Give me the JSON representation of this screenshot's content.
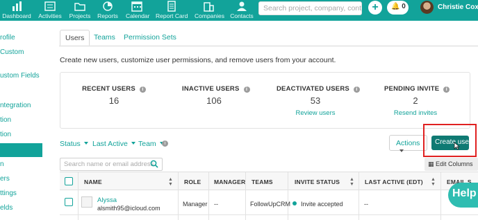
{
  "topnav": {
    "items": [
      {
        "label": "Dashboard",
        "icon": "bar-chart-icon"
      },
      {
        "label": "Activities",
        "icon": "activities-icon"
      },
      {
        "label": "Projects",
        "icon": "folder-icon"
      },
      {
        "label": "Reports",
        "icon": "reports-icon"
      },
      {
        "label": "Calendar",
        "icon": "calendar-icon"
      },
      {
        "label": "Report Card",
        "icon": "report-card-icon"
      },
      {
        "label": "Companies",
        "icon": "companies-icon"
      },
      {
        "label": "Contacts",
        "icon": "contacts-icon"
      }
    ],
    "search_placeholder": "Search project, company, contact",
    "notification_count": "0",
    "user_name": "Christie Cox",
    "accent_color": "#12a39a"
  },
  "sidebar": {
    "items": [
      "rofile",
      "Custom",
      "ustom Fields",
      "ntegration",
      "tion",
      "tion",
      "n",
      "ers",
      "ttings",
      "elds"
    ]
  },
  "tabs": [
    "Users",
    "Teams",
    "Permission Sets"
  ],
  "description": "Create new users, customize user permissions, and remove users from your account.",
  "stats": [
    {
      "title": "RECENT USERS",
      "value": "16",
      "link": ""
    },
    {
      "title": "INACTIVE USERS",
      "value": "106",
      "link": ""
    },
    {
      "title": "DEACTIVATED USERS",
      "value": "53",
      "link": "Review users"
    },
    {
      "title": "PENDING INVITE",
      "value": "2",
      "link": "Resend invites"
    }
  ],
  "filters": {
    "status": "Status",
    "last_active": "Last Active",
    "team": "Team"
  },
  "buttons": {
    "actions": "Actions",
    "create_user": "Create user",
    "edit_columns": "Edit Columns",
    "help": "Help"
  },
  "search_users_placeholder": "Search name or email address",
  "table": {
    "headers": [
      "NAME",
      "ROLE",
      "MANAGER",
      "TEAMS",
      "INVITE STATUS",
      "LAST ACTIVE (EDT)",
      "EMAIL S"
    ],
    "rows": [
      {
        "name": "Alyssa",
        "email": "alsmith95@icloud.com",
        "role": "Manager",
        "manager": "--",
        "teams": "FollowUpCRM",
        "invite_status": "Invite accepted",
        "last_active": "--"
      }
    ]
  }
}
